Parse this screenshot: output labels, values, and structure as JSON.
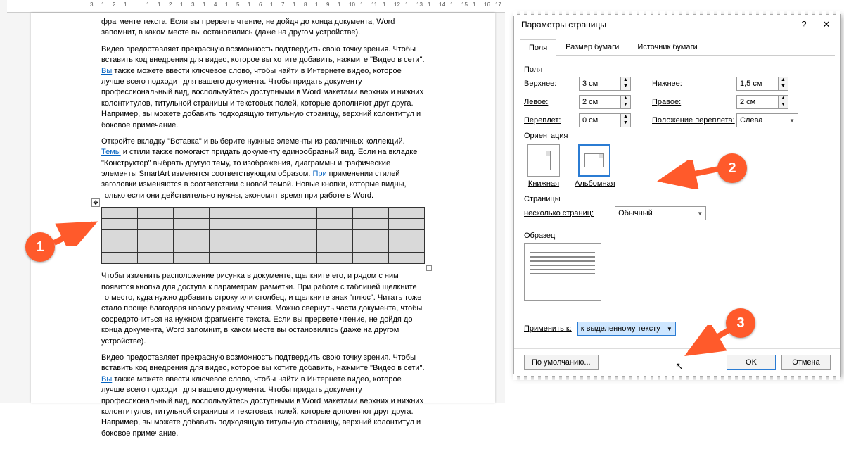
{
  "ruler_marks": [
    "3",
    "1",
    "2",
    "1",
    "",
    "1",
    "1",
    "2",
    "1",
    "3",
    "1",
    "4",
    "1",
    "5",
    "1",
    "6",
    "1",
    "7",
    "1",
    "8",
    "1",
    "9",
    "1",
    "10",
    "1",
    "11",
    "1",
    "12",
    "1",
    "13",
    "1",
    "14",
    "1",
    "15",
    "1",
    "16",
    "17"
  ],
  "document": {
    "para1": "фрагменте текста. Если вы прервете чтение, не дойдя до конца документа, Word запомнит, в каком месте вы остановились (даже на другом устройстве).",
    "para2a": "Видео предоставляет прекрасную возможность подтвердить свою точку зрения. Чтобы вставить код внедрения для видео, которое вы хотите добавить, нажмите \"Видео в сети\". ",
    "para2_link1": "Вы",
    "para2b": " также можете ввести ключевое слово, чтобы найти в Интернете видео, которое лучше всего подходит для вашего документа. Чтобы придать документу профессиональный вид, воспользуйтесь доступными в Word макетами верхних и нижних колонтитулов, титульной страницы и текстовых полей, которые дополняют друг друга. Например, вы можете добавить подходящую титульную страницу, верхний колонтитул и боковое примечание.",
    "para3a": "Откройте вкладку \"Вставка\" и выберите нужные элементы из различных коллекций. ",
    "para3_link1": "Темы",
    "para3b": " и стили также помогают придать документу единообразный вид. Если на вкладке \"Конструктор\" выбрать другую тему, то изображения, диаграммы и графические элементы SmartArt изменятся соответствующим образом. ",
    "para3_link2": "При",
    "para3c": " применении стилей заголовки изменяются в соответствии с новой темой. Новые кнопки, которые видны, только если они действительно нужны, экономят время при работе в Word.",
    "para4": "Чтобы изменить расположение рисунка в документе, щелкните его, и рядом с ним появится кнопка для доступа к параметрам разметки. При работе с таблицей щелкните то место, куда нужно добавить строку или столбец, и щелкните знак \"плюс\". Читать тоже стало проще благодаря новому режиму чтения. Можно свернуть части документа, чтобы сосредоточиться на нужном фрагменте текста. Если вы прервете чтение, не дойдя до конца документа, Word запомнит, в каком месте вы остановились (даже на другом устройстве).",
    "para5a": "Видео предоставляет прекрасную возможность подтвердить свою точку зрения. Чтобы вставить код внедрения для видео, которое вы хотите добавить, нажмите \"Видео в сети\". ",
    "para5_link1": "Вы",
    "para5b": " также можете ввести ключевое слово, чтобы найти в Интернете видео, которое лучше всего подходит для вашего документа. Чтобы придать документу профессиональный вид, воспользуйтесь доступными в Word макетами верхних и нижних колонтитулов, титульной страницы и текстовых полей, которые дополняют друг друга. Например, вы можете добавить подходящую титульную страницу, верхний колонтитул и боковое примечание."
  },
  "table": {
    "rows": 5,
    "cols": 9
  },
  "dialog": {
    "title": "Параметры страницы",
    "tabs": [
      "Поля",
      "Размер бумаги",
      "Источник бумаги"
    ],
    "active_tab": 0,
    "section_margins": "Поля",
    "margin_top_label": "Верхнее:",
    "margin_top_value": "3 см",
    "margin_bottom_label": "Нижнее:",
    "margin_bottom_value": "1,5 см",
    "margin_left_label": "Левое:",
    "margin_left_value": "2 см",
    "margin_right_label": "Правое:",
    "margin_right_value": "2 см",
    "gutter_label": "Переплет:",
    "gutter_value": "0 см",
    "gutter_pos_label": "Положение переплета:",
    "gutter_pos_value": "Слева",
    "section_orientation": "Ориентация",
    "orient_portrait": "Книжная",
    "orient_landscape": "Альбомная",
    "section_pages": "Страницы",
    "multi_pages_label": "несколько страниц:",
    "multi_pages_value": "Обычный",
    "section_preview": "Образец",
    "apply_label": "Применить к:",
    "apply_value": "к выделенному тексту",
    "default_btn": "По умолчанию...",
    "ok_btn": "OK",
    "cancel_btn": "Отмена"
  },
  "callouts": {
    "c1": "1",
    "c2": "2",
    "c3": "3"
  }
}
